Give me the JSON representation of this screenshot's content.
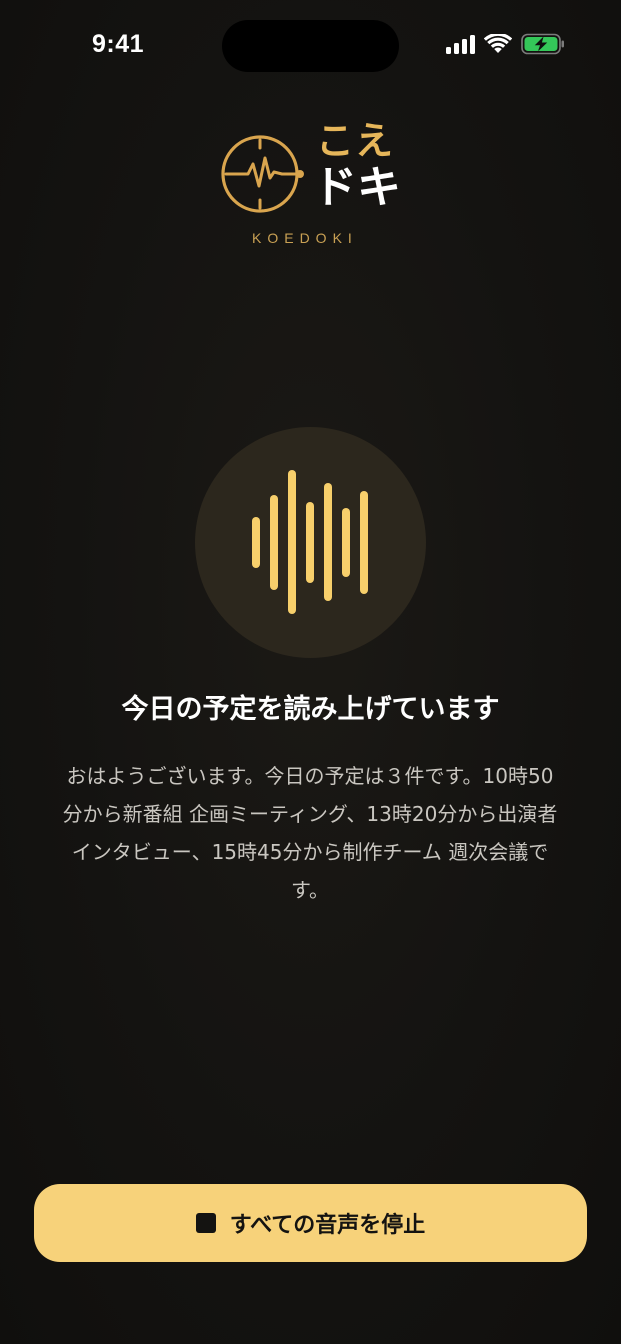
{
  "status_bar": {
    "time": "9:41",
    "icons": [
      "signal-icon",
      "wifi-icon",
      "battery-charging-icon"
    ],
    "battery_color": "#34c759"
  },
  "logo": {
    "jp_top": "こえ",
    "jp_bottom": "ドキ",
    "en": "KOEDOKI",
    "accent_color": "#e6b65a"
  },
  "voice_indicator": {
    "icon": "sound-wave-icon",
    "bar_color": "#f7cf6b",
    "circle_color": "#2c271d"
  },
  "reading": {
    "title": "今日の予定を読み上げています",
    "body": "おはようございます。今日の予定は３件です。10時50分から新番組 企画ミーティング、13時20分から出演者インタビュー、15時45分から制作チーム 週次会議です。"
  },
  "stop_button": {
    "icon": "stop-icon",
    "label": "すべての音声を停止",
    "color": "#f7d27a"
  }
}
